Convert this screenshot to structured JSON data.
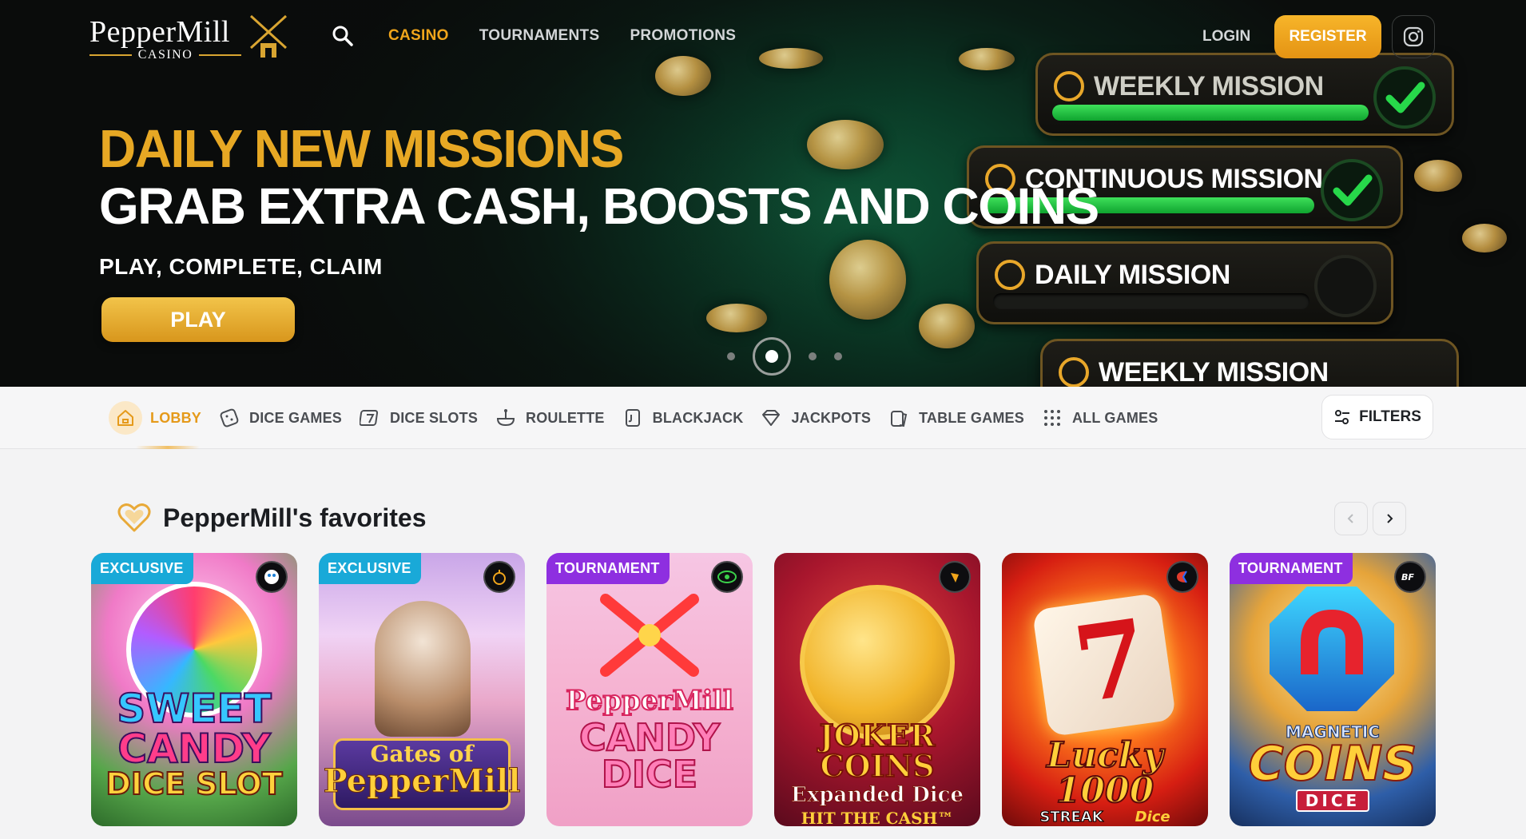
{
  "header": {
    "logo_name": "PepperMill",
    "logo_sub": "CASINO",
    "nav": [
      {
        "label": "CASINO",
        "active": true
      },
      {
        "label": "TOURNAMENTS",
        "active": false
      },
      {
        "label": "PROMOTIONS",
        "active": false
      }
    ],
    "login_label": "LOGIN",
    "register_label": "REGISTER",
    "accent_color": "#f0a51b"
  },
  "hero": {
    "line1": "DAILY NEW MISSIONS",
    "line2": "GRAB EXTRA CASH, BOOSTS AND COINS",
    "subtitle": "PLAY, COMPLETE, CLAIM",
    "play_label": "PLAY",
    "missions": [
      {
        "label": "WEEKLY MISSION",
        "progress": 1.0,
        "complete": true
      },
      {
        "label": "CONTINUOUS MISSION",
        "progress": 1.0,
        "complete": true
      },
      {
        "label": "DAILY MISSION",
        "progress": 0.0,
        "complete": false
      },
      {
        "label": "WEEKLY MISSION",
        "progress": 0.0,
        "complete": false
      }
    ],
    "slides_total": 4,
    "slide_active": 2
  },
  "categories": {
    "items": [
      {
        "label": "LOBBY",
        "icon": "home-icon",
        "active": true
      },
      {
        "label": "DICE GAMES",
        "icon": "dice-icon",
        "active": false
      },
      {
        "label": "DICE SLOTS",
        "icon": "slot-seven-icon",
        "active": false
      },
      {
        "label": "ROULETTE",
        "icon": "roulette-icon",
        "active": false
      },
      {
        "label": "BLACKJACK",
        "icon": "cards-icon",
        "active": false
      },
      {
        "label": "JACKPOTS",
        "icon": "diamond-icon",
        "active": false
      },
      {
        "label": "TABLE GAMES",
        "icon": "table-cards-icon",
        "active": false
      },
      {
        "label": "ALL GAMES",
        "icon": "grid-dots-icon",
        "active": false
      }
    ],
    "filters_label": "FILTERS"
  },
  "favorites": {
    "title": "PepperMill's favorites",
    "games": [
      {
        "badge": "EXCLUSIVE",
        "title_lines": [
          "SWEET",
          "CANDY",
          "DICE SLOT"
        ],
        "provider_icon": "provider-icon"
      },
      {
        "badge": "EXCLUSIVE",
        "title_lines": [
          "Gates of",
          "PepperMill"
        ],
        "provider_icon": "provider-icon"
      },
      {
        "badge": "TOURNAMENT",
        "title_lines": [
          "PepperMill",
          "CANDY",
          "DICE"
        ],
        "provider_icon": "provider-icon"
      },
      {
        "badge": "",
        "title_lines": [
          "JOKER COINS",
          "Expanded Dice",
          "HIT THE CASH™"
        ],
        "provider_icon": "provider-icon"
      },
      {
        "badge": "",
        "title_lines": [
          "Lucky 1000",
          "STREAK",
          "Dice"
        ],
        "provider_icon": "provider-icon"
      },
      {
        "badge": "TOURNAMENT",
        "title_lines": [
          "MAGNETIC",
          "COINS",
          "DICE"
        ],
        "provider_icon": "provider-icon"
      }
    ]
  }
}
